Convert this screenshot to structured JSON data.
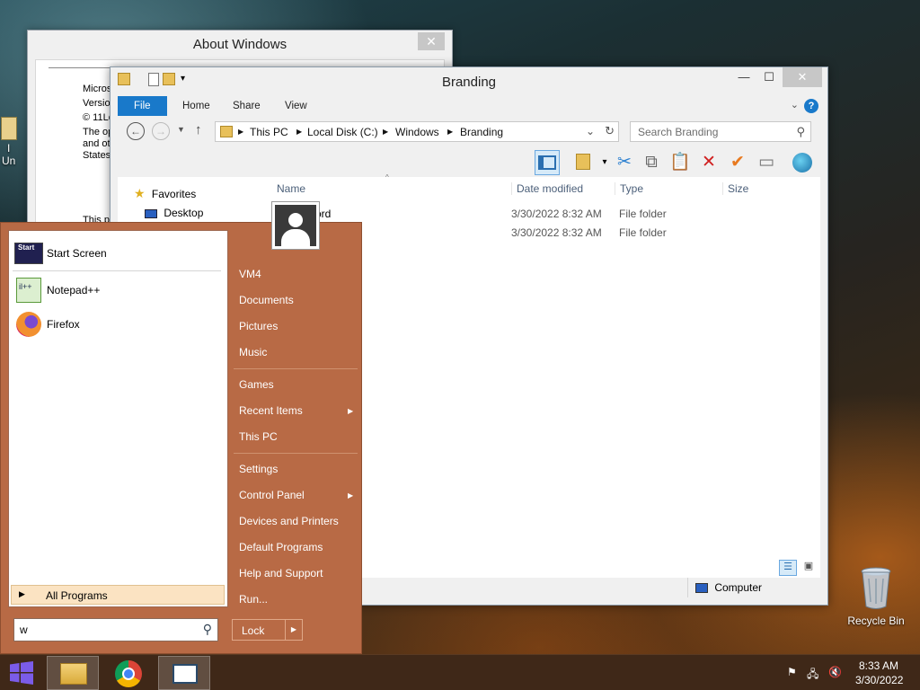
{
  "desktop": {
    "recycle_bin": "Recycle Bin",
    "left_icon_partial_1": "I",
    "left_icon_partial_2": "Un"
  },
  "about_window": {
    "title": "About Windows",
    "lines": [
      "Microso",
      "Version",
      "© 11Le",
      "The op",
      "and oth",
      "States",
      "This pr"
    ]
  },
  "explorer": {
    "title": "Branding",
    "tabs": [
      "File",
      "Home",
      "Share",
      "View"
    ],
    "breadcrumbs": [
      "This PC",
      "Local Disk (C:)",
      "Windows",
      "Branding"
    ],
    "search_placeholder": "Search Branding",
    "columns": [
      "Name",
      "Date modified",
      "Type",
      "Size"
    ],
    "nav": {
      "favorites": "Favorites",
      "desktop": "Desktop"
    },
    "rows": [
      {
        "name": "ord",
        "date": "3/30/2022 8:32 AM",
        "type": "File folder"
      },
      {
        "name": "",
        "date": "3/30/2022 8:32 AM",
        "type": "File folder"
      }
    ],
    "status_location": "Computer"
  },
  "start_menu": {
    "pinned": [
      "Start Screen",
      "Notepad++",
      "Firefox"
    ],
    "all_programs": "All Programs",
    "search_value": "w",
    "right_items": [
      "VM4",
      "Documents",
      "Pictures",
      "Music",
      "Games",
      "Recent Items",
      "This PC",
      "Settings",
      "Control Panel",
      "Devices and Printers",
      "Default Programs",
      "Help and Support",
      "Run..."
    ],
    "lock": "Lock",
    "start_icon_text": "Start"
  },
  "taskbar": {
    "time": "8:33 AM",
    "date": "3/30/2022"
  },
  "colors": {
    "start_menu_bg": "#b86a45",
    "file_tab": "#1979ca",
    "taskbar": "#3f2818"
  }
}
